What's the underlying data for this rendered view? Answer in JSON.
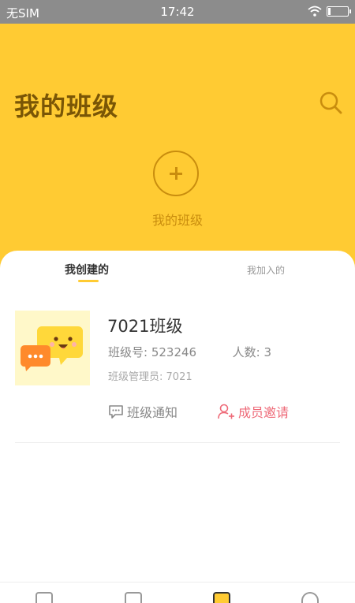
{
  "status_bar": {
    "carrier": "无SIM",
    "time": "17:42"
  },
  "header": {
    "title": "我的班级",
    "add_label": "我的班级"
  },
  "tabs": [
    {
      "label": "我创建的"
    },
    {
      "label": "我加入的"
    }
  ],
  "class_item": {
    "name": "7021班级",
    "class_no_label": "班级号:",
    "class_no": "523246",
    "members_label": "人数:",
    "members": "3",
    "manager_label": "班级管理员:",
    "manager": "7021",
    "notice_label": "班级通知",
    "invite_label": "成员邀请"
  },
  "colors": {
    "accent": "#ffcb33",
    "title": "#7a5606",
    "icon": "#c98d0e",
    "invite": "#ee6a78"
  }
}
